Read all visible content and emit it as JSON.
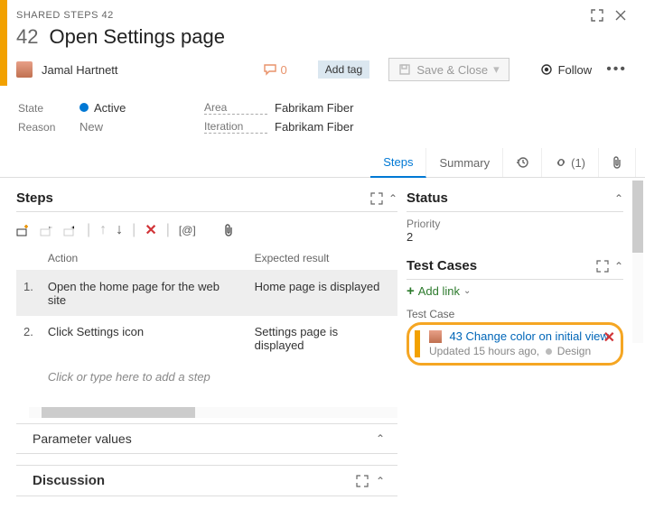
{
  "header": {
    "type_label": "SHARED STEPS 42",
    "id": "42",
    "title": "Open Settings page",
    "assigned_to": "Jamal Hartnett",
    "discussion_count": "0",
    "add_tag_label": "Add tag",
    "save_close_label": "Save & Close",
    "follow_label": "Follow"
  },
  "fields": {
    "state_label": "State",
    "state_value": "Active",
    "area_label": "Area",
    "area_value": "Fabrikam Fiber",
    "reason_label": "Reason",
    "reason_value": "New",
    "iteration_label": "Iteration",
    "iteration_value": "Fabrikam Fiber"
  },
  "tabs": {
    "steps": "Steps",
    "summary": "Summary",
    "links_count": "(1)"
  },
  "steps": {
    "heading": "Steps",
    "columns": {
      "action": "Action",
      "expected": "Expected result"
    },
    "rows": [
      {
        "num": "1.",
        "action": "Open the home page for the web site",
        "expected": "Home page is displayed"
      },
      {
        "num": "2.",
        "action": "Click Settings icon",
        "expected": "Settings page is displayed"
      }
    ],
    "placeholder": "Click or type here to add a step"
  },
  "param": {
    "heading": "Parameter values"
  },
  "discussion": {
    "heading": "Discussion"
  },
  "status": {
    "heading": "Status",
    "priority_label": "Priority",
    "priority_value": "2"
  },
  "testcases": {
    "heading": "Test Cases",
    "add_link": "Add link",
    "label": "Test Case",
    "item": {
      "id": "43",
      "title": "Change color on initial view",
      "updated": "Updated 15 hours ago,",
      "state": "Design"
    }
  }
}
